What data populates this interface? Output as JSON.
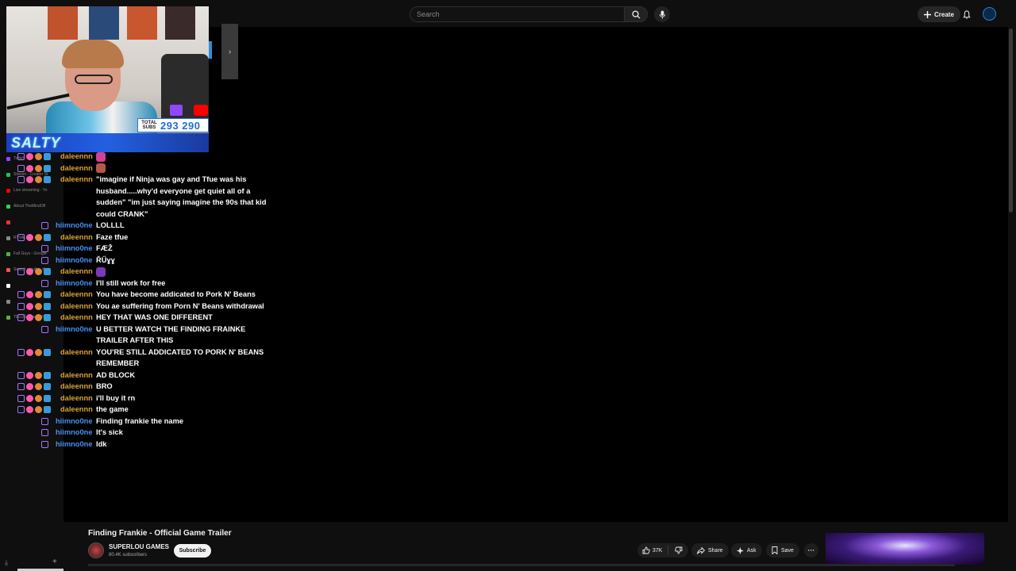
{
  "header": {
    "search_placeholder": "Search",
    "create_label": "Create",
    "icons": [
      "search-icon",
      "mic-icon",
      "plus-icon",
      "bell-icon",
      "avatar"
    ]
  },
  "overlay": {
    "subs_label": "TOTAL SUBS",
    "subs_count": "293 290",
    "brand": "SALTY"
  },
  "sidebar_ghost": [
    {
      "label": "Twitch",
      "color": "#9146ff"
    },
    {
      "label": "Stream - Creator St",
      "color": "#1fbf5f"
    },
    {
      "label": "Live streaming - Yo",
      "color": "#ff0000"
    },
    {
      "label": "About TheMindOfl",
      "color": "#2fd05a"
    },
    {
      "label": "",
      "color": "#ff3030"
    },
    {
      "label": "RYVAL",
      "color": "#888"
    },
    {
      "label": "Fall Guys - Google",
      "color": "#4caf50"
    },
    {
      "label": "Search results - the",
      "color": "#e55"
    },
    {
      "label": "",
      "color": "#fff"
    },
    {
      "label": "",
      "color": "#888"
    },
    {
      "label": "TELUS Boost Wi-Fi",
      "color": "#6a4"
    }
  ],
  "chat": [
    {
      "user": "daleennn",
      "type": "mod",
      "text": "",
      "emote": "#d1409a"
    },
    {
      "user": "daleennn",
      "type": "mod",
      "text": "",
      "emote": "#b5584a"
    },
    {
      "user": "daleennn",
      "type": "mod",
      "text": "\"imagine if Ninja was gay and Tfue was his husband.....why'd everyone get quiet all of a sudden\" \"im just saying imagine the 90s that kid could CRANK\""
    },
    {
      "user": "hiimno0ne",
      "type": "sub",
      "text": "LOLLLL"
    },
    {
      "user": "daleennn",
      "type": "mod",
      "text": "Faze tfue"
    },
    {
      "user": "hiimno0ne",
      "type": "sub",
      "text": "FÆŽ"
    },
    {
      "user": "hiimno0ne",
      "type": "sub",
      "text": "ŘŰɣɣ"
    },
    {
      "user": "daleennn",
      "type": "mod",
      "text": "",
      "emote": "#7a3ab5"
    },
    {
      "user": "hiimno0ne",
      "type": "sub",
      "text": "I'll still work for free"
    },
    {
      "user": "daleennn",
      "type": "mod",
      "text": "You have become addicated to Pork N' Beans"
    },
    {
      "user": "daleennn",
      "type": "mod",
      "text": "You ae suffering from Porn N' Beans withdrawal"
    },
    {
      "user": "daleennn",
      "type": "mod",
      "text": "HEY THAT WAS ONE DIFFERENT"
    },
    {
      "user": "hiimno0ne",
      "type": "sub",
      "text": "U BETTER WATCH THE FINDING FRAINKE TRAILER AFTER THIS"
    },
    {
      "user": "daleennn",
      "type": "mod",
      "text": "YOU'RE STILL ADDICATED TO PORK N' BEANS REMEMBER"
    },
    {
      "user": "daleennn",
      "type": "mod",
      "text": "AD BLOCK"
    },
    {
      "user": "daleennn",
      "type": "mod",
      "text": "BRO"
    },
    {
      "user": "daleennn",
      "type": "mod",
      "text": "i'll buy it rn"
    },
    {
      "user": "daleennn",
      "type": "mod",
      "text": "the game"
    },
    {
      "user": "hiimno0ne",
      "type": "sub",
      "text": "Finding frankie the name"
    },
    {
      "user": "hiimno0ne",
      "type": "sub",
      "text": "It's sick"
    },
    {
      "user": "hiimno0ne",
      "type": "sub",
      "text": "Idk"
    }
  ],
  "video": {
    "title": "Finding Frankie - Official Game Trailer",
    "channel": "SUPERLOU GAMES",
    "subscribers": "80.4K subscribers",
    "subscribe_label": "Subscribe",
    "likes": "37K",
    "share_label": "Share",
    "ask_label": "Ask",
    "save_label": "Save"
  }
}
